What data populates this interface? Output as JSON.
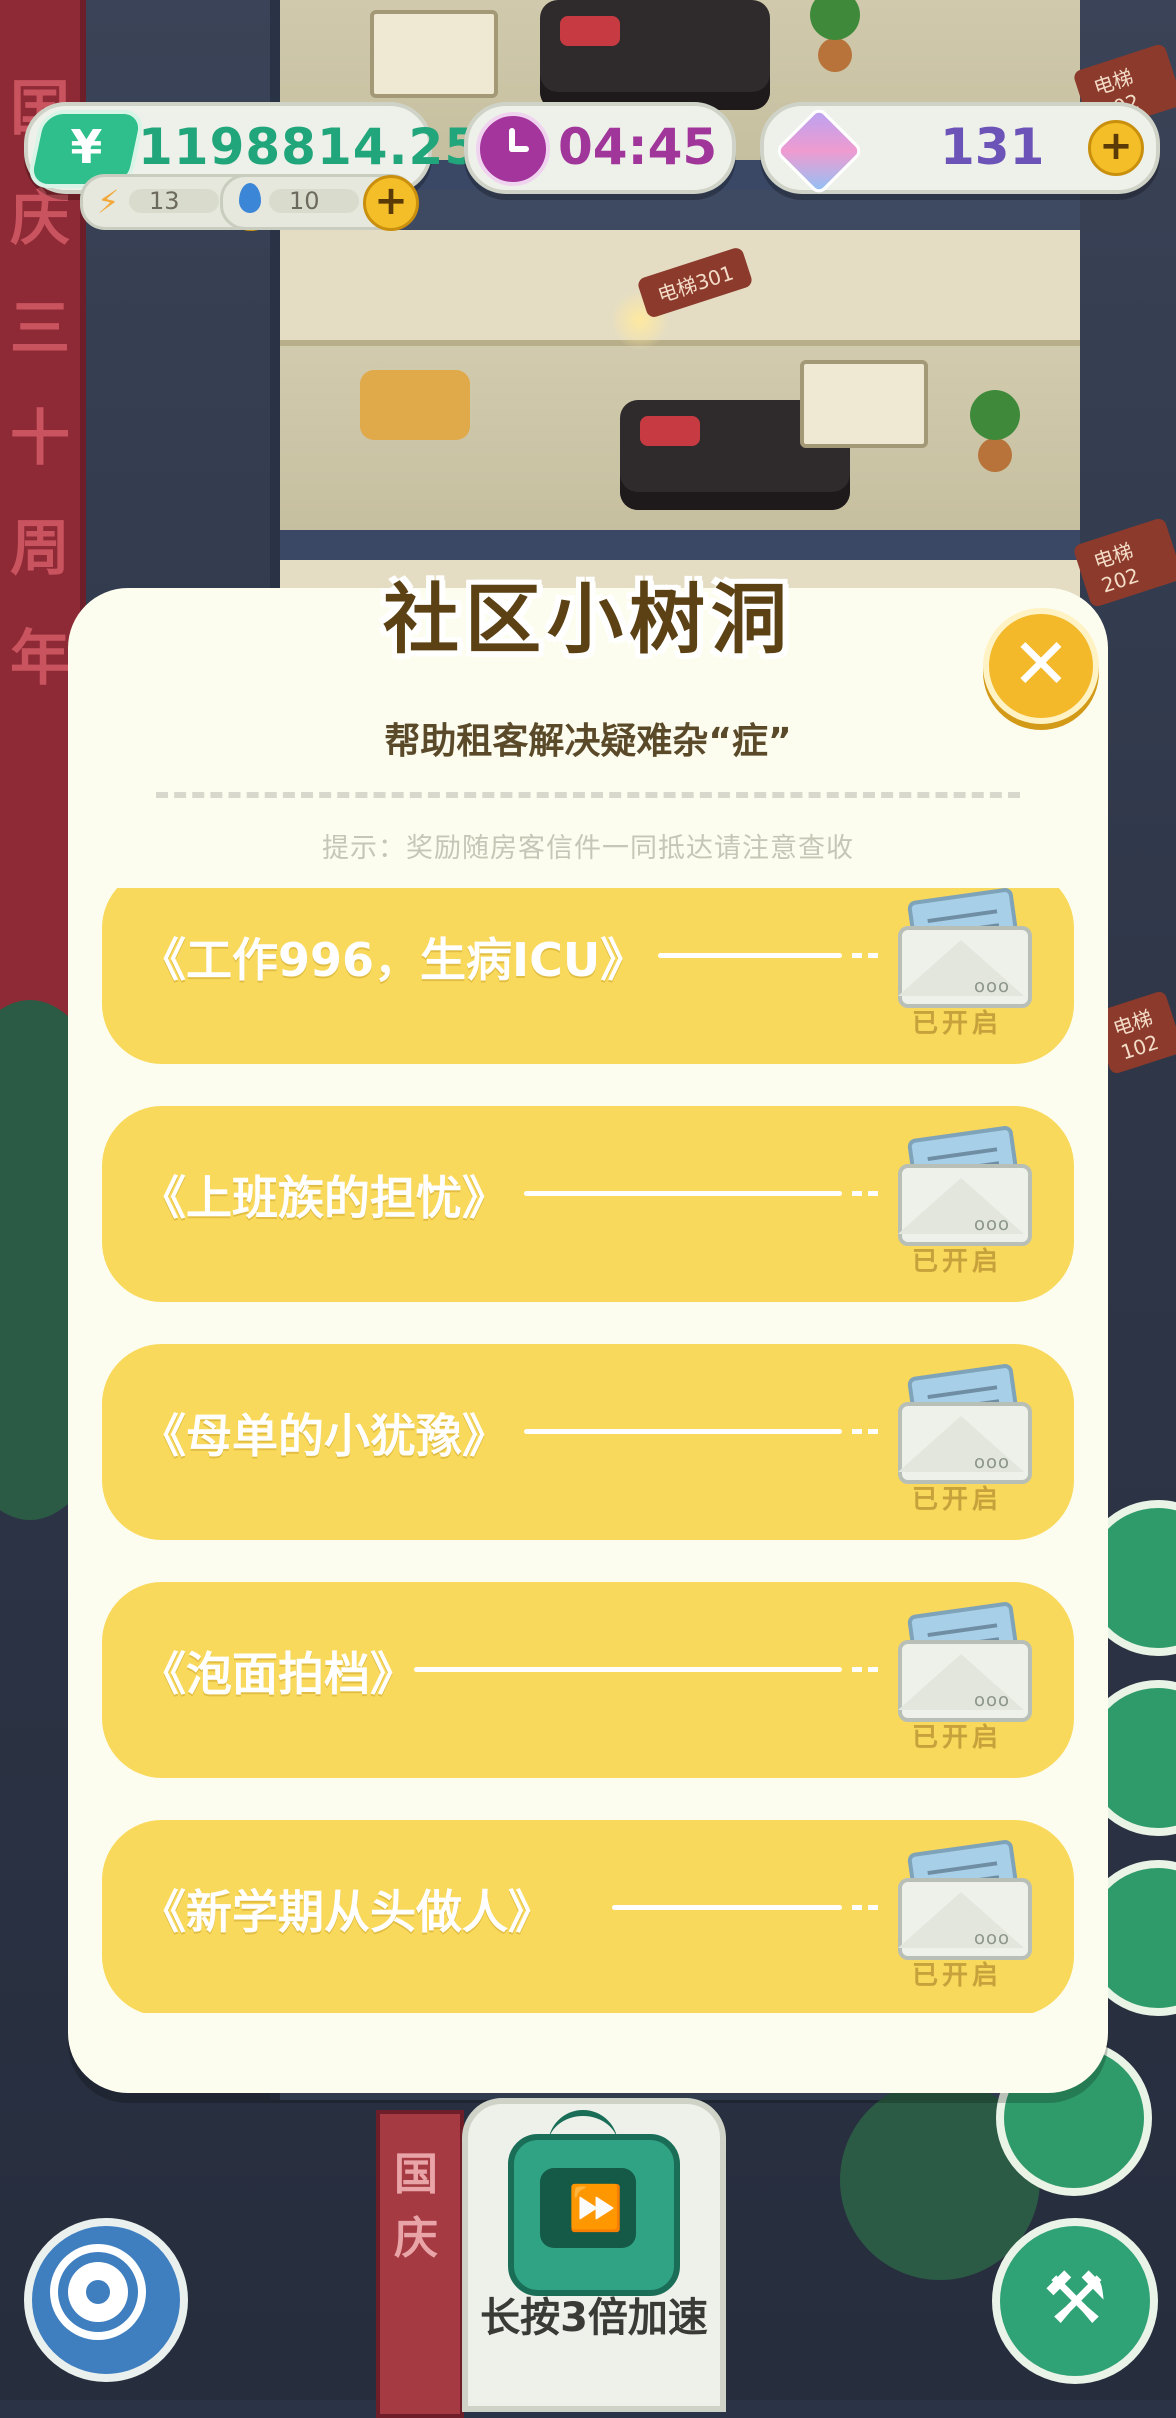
{
  "hud": {
    "money": {
      "icon": "yen-icon",
      "symbol": "¥",
      "value": "1198814.25"
    },
    "energy": {
      "icon": "lightning-icon",
      "value": "13"
    },
    "water": {
      "icon": "water-drop-icon",
      "value": "10"
    },
    "timer": {
      "icon": "clock-icon",
      "value": "04:45"
    },
    "gems": {
      "icon": "gem-icon",
      "value": "131"
    }
  },
  "background": {
    "elevator_tags": [
      "电梯302",
      "电梯301",
      "电梯202",
      "电梯102"
    ],
    "banner_text": "国庆"
  },
  "modal": {
    "title": "社区小树洞",
    "subtitle": "帮助租客解决疑难杂“症”",
    "hint": "提示：奖励随房客信件一同抵达请注意查收",
    "close_icon": "close-icon",
    "letters": [
      {
        "title": "《工作996，生病ICU》",
        "status": "已开启"
      },
      {
        "title": "《上班族的担忧》",
        "status": "已开启"
      },
      {
        "title": "《母单的小犹豫》",
        "status": "已开启"
      },
      {
        "title": "《泡面拍档》",
        "status": "已开启"
      },
      {
        "title": "《新学期从头做人》",
        "status": "已开启"
      }
    ]
  },
  "controls": {
    "speed_label": "长按3倍加速",
    "speed_icon": "fast-forward-tv-icon",
    "settings_icon": "gear-icon",
    "tools_icon": "tools-icon"
  },
  "colors": {
    "modal_bg": "#fdfdef",
    "letter_bg": "#f9d95c",
    "money_green": "#21a57a",
    "timer_purple": "#a0359a",
    "gem_purple": "#6c53b8"
  }
}
